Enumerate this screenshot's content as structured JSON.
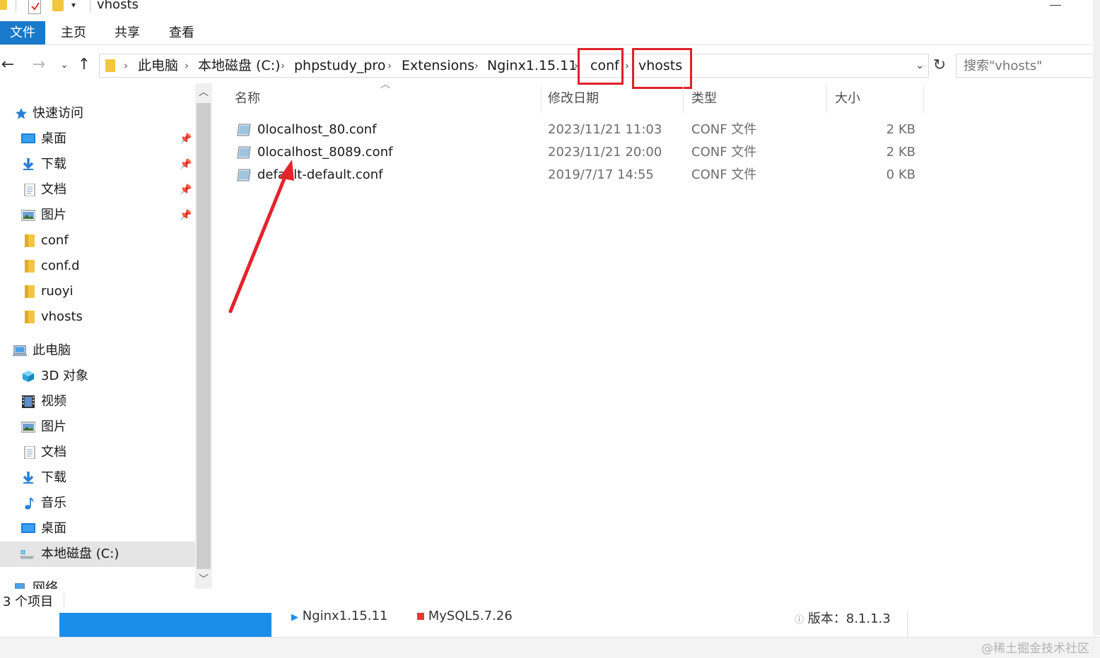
{
  "window": {
    "title": "vhosts"
  },
  "ribbon": {
    "tabs": [
      "文件",
      "主页",
      "共享",
      "查看"
    ]
  },
  "address": {
    "breadcrumbs": [
      "此电脑",
      "本地磁盘 (C:)",
      "phpstudy_pro",
      "Extensions",
      "Nginx1.15.11",
      "conf",
      "vhosts"
    ],
    "search_placeholder": "搜索\"vhosts\""
  },
  "navpane": {
    "items": [
      {
        "label": "快速访问",
        "icon": "star-icon"
      },
      {
        "label": "桌面",
        "icon": "desktop-icon"
      },
      {
        "label": "下载",
        "icon": "download-icon"
      },
      {
        "label": "文档",
        "icon": "document-icon"
      },
      {
        "label": "图片",
        "icon": "picture-icon"
      },
      {
        "label": "conf",
        "icon": "folder-icon"
      },
      {
        "label": "conf.d",
        "icon": "folder-icon"
      },
      {
        "label": "ruoyi",
        "icon": "folder-icon"
      },
      {
        "label": "vhosts",
        "icon": "folder-icon"
      },
      {
        "label": "此电脑",
        "icon": "computer-icon"
      },
      {
        "label": "3D 对象",
        "icon": "3d-objects-icon"
      },
      {
        "label": "视频",
        "icon": "video-icon"
      },
      {
        "label": "图片",
        "icon": "picture-icon"
      },
      {
        "label": "文档",
        "icon": "document-icon"
      },
      {
        "label": "下载",
        "icon": "download-icon"
      },
      {
        "label": "音乐",
        "icon": "music-icon"
      },
      {
        "label": "桌面",
        "icon": "desktop-icon"
      },
      {
        "label": "本地磁盘 (C:)",
        "icon": "drive-icon"
      },
      {
        "label": "网络",
        "icon": "network-icon"
      }
    ]
  },
  "filelist": {
    "columns": [
      "名称",
      "修改日期",
      "类型",
      "大小"
    ],
    "rows": [
      {
        "name": "0localhost_80.conf",
        "date": "2023/11/21 11:03",
        "type": "CONF 文件",
        "size": "2 KB"
      },
      {
        "name": "0localhost_8089.conf",
        "date": "2023/11/21 20:00",
        "type": "CONF 文件",
        "size": "2 KB"
      },
      {
        "name": "default-default.conf",
        "date": "2019/7/17 14:55",
        "type": "CONF 文件",
        "size": "0 KB"
      }
    ]
  },
  "status": {
    "item_count": "3 个项目"
  },
  "background_window": {
    "nginx": "Nginx1.15.11",
    "mysql": "MySQL5.7.26",
    "version": "版本：8.1.1.3"
  },
  "watermark": "@稀土掘金技术社区",
  "colors": {
    "accent": "#1979ca",
    "highlight": "#e0202b",
    "selected_nav": "#e5e5e5"
  }
}
